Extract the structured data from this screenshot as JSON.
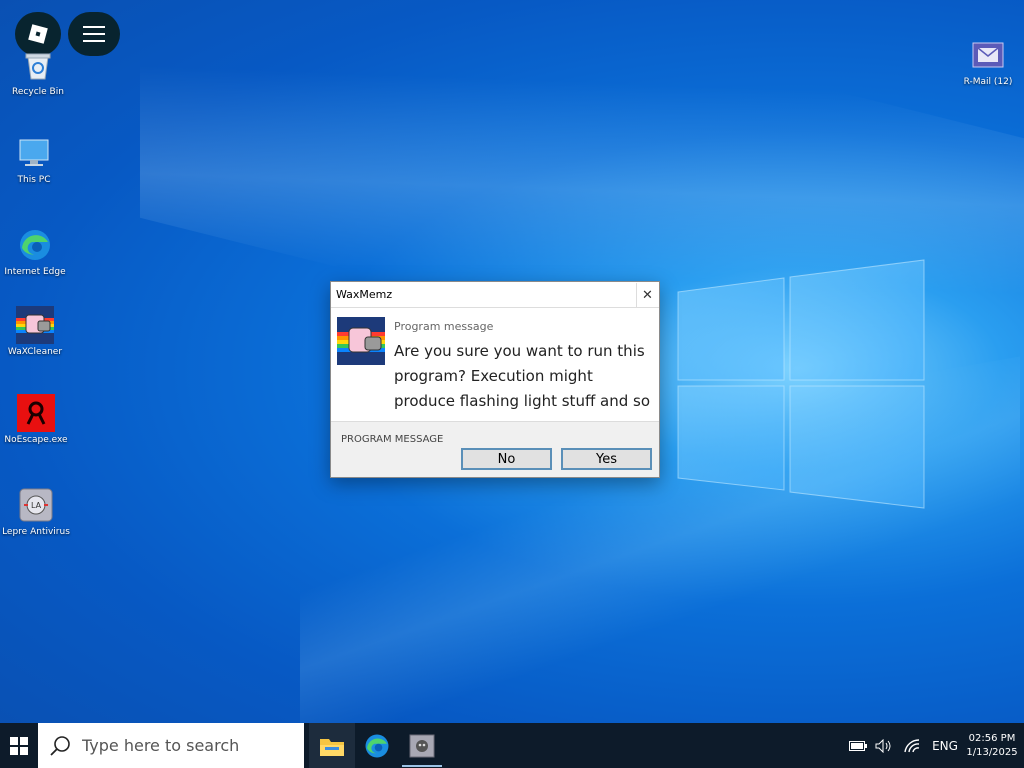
{
  "desktop": {
    "icons": [
      {
        "label": "Recycle Bin",
        "icon": "recycle-bin-icon"
      },
      {
        "label": "This PC",
        "icon": "computer-icon"
      },
      {
        "label": "Internet Edge",
        "icon": "edge-icon"
      },
      {
        "label": "WaXCleaner",
        "icon": "nyan-cat-icon"
      },
      {
        "label": "NoEscape.exe",
        "icon": "noescape-icon"
      },
      {
        "label": "Lepre Antivirus",
        "icon": "antivirus-icon"
      },
      {
        "label": "R-Mail (12)",
        "icon": "mail-icon"
      }
    ]
  },
  "overlay": {
    "roblox_icon": "roblox-icon",
    "menu_icon": "hamburger-menu-icon"
  },
  "dialog": {
    "title": "WaxMemz",
    "close_glyph": "✕",
    "subtitle": "Program message",
    "message": "Are you sure you want to run this program? Execution might produce flashing light stuff and so on.",
    "footer_label": "PROGRAM MESSAGE",
    "no_label": "No",
    "yes_label": "Yes"
  },
  "taskbar": {
    "search_placeholder": "Type here to search",
    "language": "ENG",
    "time": "02:56 PM",
    "date": "1/13/2025",
    "apps": [
      "file-explorer-icon",
      "edge-icon",
      "waxmemz-icon"
    ]
  },
  "colors": {
    "desktop_blue": "#0759c4",
    "taskbar": "#0d1b2a",
    "button_border": "#5a8fb8"
  }
}
